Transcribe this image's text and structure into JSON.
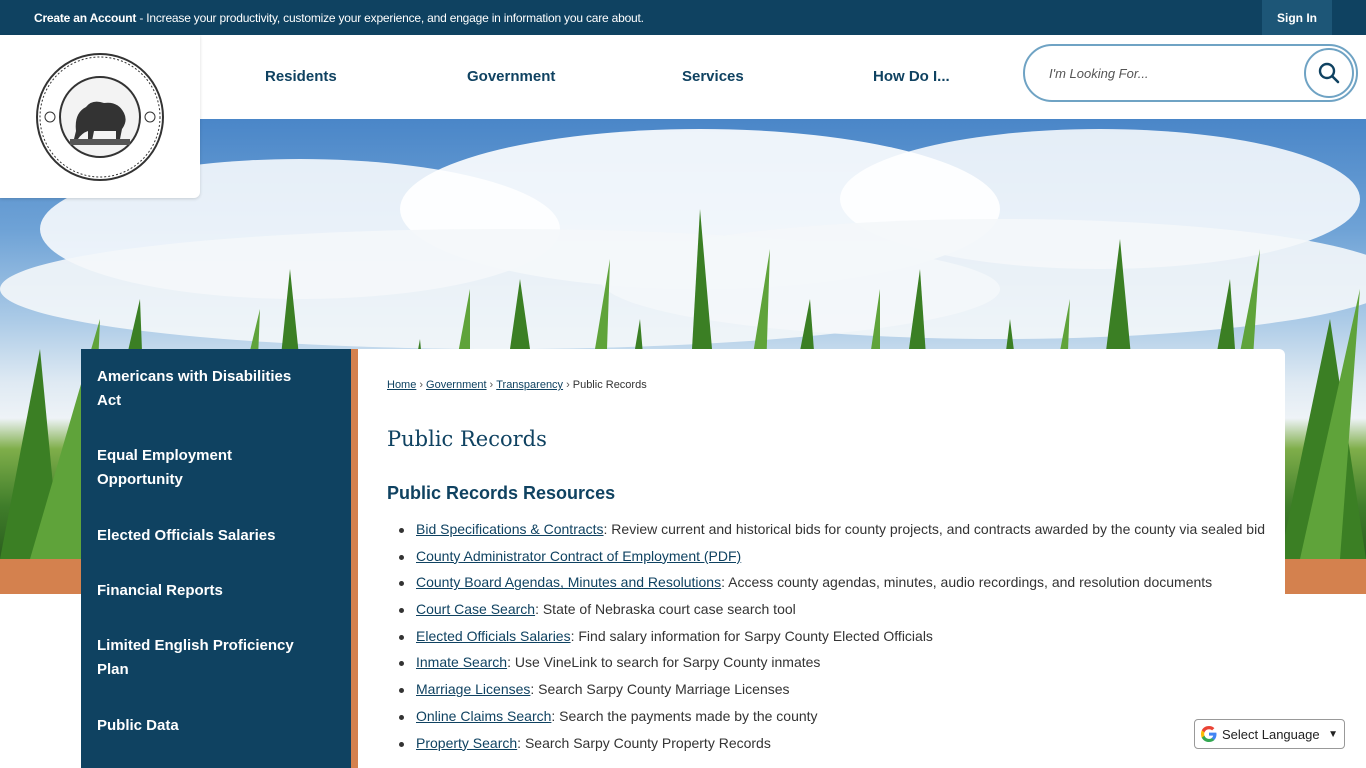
{
  "topbar": {
    "create_account": "Create an Account",
    "message": " - Increase your productivity, customize your experience, and engage in information you care about.",
    "sign_in": "Sign In"
  },
  "nav": {
    "items": [
      "Residents",
      "Government",
      "Services",
      "How Do I..."
    ]
  },
  "search": {
    "placeholder": "I'm Looking For..."
  },
  "sidenav": {
    "items": [
      "Americans with Disabilities Act",
      "Equal Employment Opportunity",
      "Elected Officials Salaries",
      "Financial Reports",
      "Limited English Proficiency Plan",
      "Public Data"
    ]
  },
  "breadcrumb": {
    "home": "Home",
    "government": "Government",
    "transparency": "Transparency",
    "current": "Public Records",
    "separator": "›"
  },
  "page": {
    "title": "Public Records",
    "section_title": "Public Records Resources"
  },
  "resources": [
    {
      "link": "Bid Specifications & Contracts",
      "desc": ": Review current and historical bids for county projects, and contracts awarded by the county via sealed bid"
    },
    {
      "link": "County Administrator Contract of Employment (PDF)",
      "desc": ""
    },
    {
      "link": "County Board Agendas, Minutes and Resolutions",
      "desc": ": Access county agendas, minutes, audio recordings, and resolution documents"
    },
    {
      "link": "Court Case Search",
      "desc": ": State of Nebraska court case search tool"
    },
    {
      "link": "Elected Officials Salaries",
      "desc": ": Find salary information for Sarpy County Elected Officials"
    },
    {
      "link": "Inmate Search",
      "desc": ": Use VineLink to search for Sarpy County inmates"
    },
    {
      "link": "Marriage Licenses",
      "desc": ": Search Sarpy County Marriage Licenses"
    },
    {
      "link": "Online Claims Search",
      "desc": ": Search the payments made by the county"
    },
    {
      "link": "Property Search",
      "desc": ": Search Sarpy County Property Records"
    }
  ],
  "translate": {
    "label": "Select Language"
  },
  "colors": {
    "primary": "#0f4261",
    "accent": "#d4814e",
    "search_border": "#6fa3c4"
  }
}
